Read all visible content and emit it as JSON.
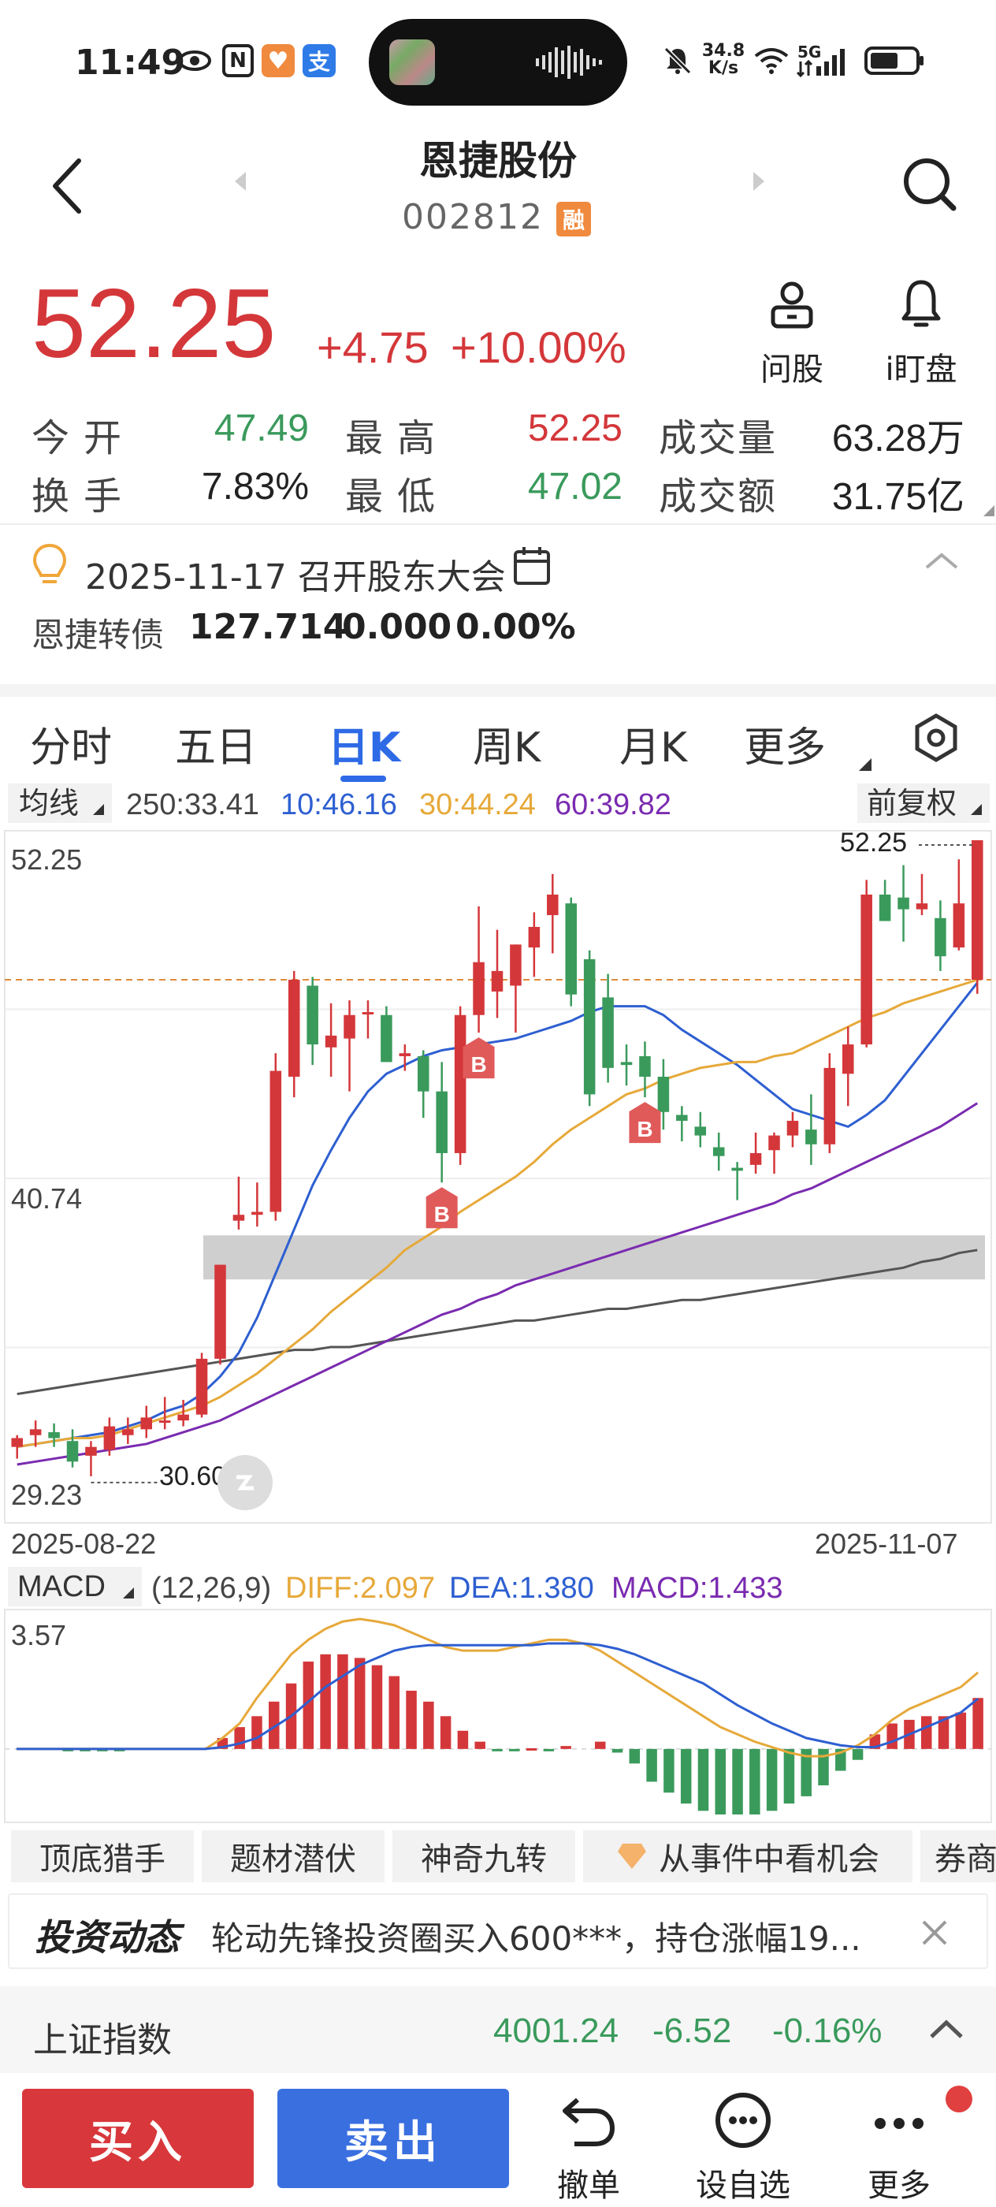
{
  "status_bar": {
    "time": "11:49",
    "net_speed_value": "34.8",
    "net_speed_unit": "K/s",
    "signal": "5G",
    "nfc_label": "N",
    "alipay_label": "支"
  },
  "header": {
    "name": "恩捷股份",
    "code": "002812",
    "margin_badge": "融"
  },
  "quote": {
    "price": "52.25",
    "change": "+4.75",
    "change_pct": "+10.00%",
    "ask_label": "问股",
    "watch_label": "i盯盘",
    "stats": [
      {
        "label": "今开",
        "value": "47.49",
        "color": "#3a9a5c"
      },
      {
        "label": "最高",
        "value": "52.25",
        "color": "#d4373a"
      },
      {
        "label": "成交量",
        "value": "63.28万",
        "color": "#222"
      },
      {
        "label": "换手",
        "value": "7.83%",
        "color": "#222"
      },
      {
        "label": "最低",
        "value": "47.02",
        "color": "#3a9a5c"
      },
      {
        "label": "成交额",
        "value": "31.75亿",
        "color": "#222"
      }
    ]
  },
  "notice": {
    "event": "2025-11-17 召开股东大会",
    "bond_name": "恩捷转债",
    "bond_price": "127.714",
    "bond_change": "0.000",
    "bond_pct": "0.00%"
  },
  "tabs": [
    "分时",
    "五日",
    "日K",
    "周K",
    "月K",
    "更多"
  ],
  "active_tab": "日K",
  "ma_bar": {
    "label": "均线",
    "ma250": "250:33.41",
    "ma10": "10:46.16",
    "ma30": "30:44.24",
    "ma60": "60:39.82",
    "adjust": "前复权"
  },
  "colors": {
    "up": "#d4373a",
    "down": "#3a9a5c",
    "ma10": "#2e5fd1",
    "ma30": "#e6a93a",
    "ma60": "#7a2bb0",
    "ma250": "#555555",
    "accent": "#2e6ae6",
    "signal_b": "#e05a5a"
  },
  "chart_data": [
    {
      "type": "candlestick",
      "y_labels": [
        "52.25",
        "40.74",
        "29.23"
      ],
      "ylim": [
        29.23,
        52.25
      ],
      "x_start": "2025-08-22",
      "x_end": "2025-11-07",
      "max_label": "52.25",
      "min_label": "30.60",
      "reference_price": 47.5,
      "support_zone": [
        37.3,
        38.8
      ],
      "signal_label": "B",
      "signals_at_index": [
        23,
        25,
        34
      ],
      "candles": [
        {
          "o": 31.6,
          "h": 32.0,
          "l": 31.2,
          "c": 31.9
        },
        {
          "o": 32.0,
          "h": 32.5,
          "l": 31.6,
          "c": 32.2
        },
        {
          "o": 32.1,
          "h": 32.4,
          "l": 31.6,
          "c": 31.9
        },
        {
          "o": 31.8,
          "h": 32.2,
          "l": 30.9,
          "c": 31.1
        },
        {
          "o": 31.3,
          "h": 31.8,
          "l": 30.6,
          "c": 31.6
        },
        {
          "o": 31.5,
          "h": 32.6,
          "l": 31.3,
          "c": 32.3
        },
        {
          "o": 32.0,
          "h": 32.6,
          "l": 31.7,
          "c": 32.2
        },
        {
          "o": 32.2,
          "h": 33.0,
          "l": 31.9,
          "c": 32.6
        },
        {
          "o": 32.5,
          "h": 33.3,
          "l": 32.2,
          "c": 32.5
        },
        {
          "o": 32.5,
          "h": 33.2,
          "l": 32.3,
          "c": 32.7
        },
        {
          "o": 32.7,
          "h": 34.8,
          "l": 32.6,
          "c": 34.6
        },
        {
          "o": 34.6,
          "h": 37.8,
          "l": 34.4,
          "c": 37.8
        },
        {
          "o": 39.3,
          "h": 40.8,
          "l": 39.0,
          "c": 39.5
        },
        {
          "o": 39.5,
          "h": 40.6,
          "l": 39.1,
          "c": 39.6
        },
        {
          "o": 39.6,
          "h": 45.0,
          "l": 39.3,
          "c": 44.4
        },
        {
          "o": 44.2,
          "h": 47.8,
          "l": 43.5,
          "c": 47.5
        },
        {
          "o": 47.3,
          "h": 47.6,
          "l": 44.6,
          "c": 45.3
        },
        {
          "o": 45.2,
          "h": 46.7,
          "l": 44.2,
          "c": 45.6
        },
        {
          "o": 45.5,
          "h": 46.8,
          "l": 43.7,
          "c": 46.3
        },
        {
          "o": 46.4,
          "h": 46.8,
          "l": 45.5,
          "c": 46.4
        },
        {
          "o": 46.3,
          "h": 46.6,
          "l": 45.0,
          "c": 44.7
        },
        {
          "o": 44.9,
          "h": 45.3,
          "l": 44.4,
          "c": 45.0
        },
        {
          "o": 44.9,
          "h": 45.1,
          "l": 42.8,
          "c": 43.7
        },
        {
          "o": 43.7,
          "h": 44.7,
          "l": 40.6,
          "c": 41.6
        },
        {
          "o": 41.6,
          "h": 46.6,
          "l": 41.2,
          "c": 46.3
        },
        {
          "o": 46.3,
          "h": 50.0,
          "l": 45.7,
          "c": 48.1
        },
        {
          "o": 47.1,
          "h": 49.2,
          "l": 46.2,
          "c": 47.8
        },
        {
          "o": 47.3,
          "h": 48.7,
          "l": 45.7,
          "c": 48.7
        },
        {
          "o": 48.6,
          "h": 49.8,
          "l": 47.6,
          "c": 49.3
        },
        {
          "o": 49.7,
          "h": 51.1,
          "l": 48.4,
          "c": 50.4
        },
        {
          "o": 50.1,
          "h": 50.3,
          "l": 46.6,
          "c": 47.0
        },
        {
          "o": 48.2,
          "h": 48.5,
          "l": 43.2,
          "c": 43.6
        },
        {
          "o": 46.9,
          "h": 47.7,
          "l": 44.0,
          "c": 44.5
        },
        {
          "o": 44.7,
          "h": 45.3,
          "l": 43.9,
          "c": 44.6
        },
        {
          "o": 44.9,
          "h": 45.4,
          "l": 43.5,
          "c": 44.2
        },
        {
          "o": 44.2,
          "h": 44.8,
          "l": 42.4,
          "c": 43.0
        },
        {
          "o": 42.9,
          "h": 43.2,
          "l": 42.0,
          "c": 42.7
        },
        {
          "o": 42.5,
          "h": 43.0,
          "l": 41.8,
          "c": 42.2
        },
        {
          "o": 41.8,
          "h": 42.3,
          "l": 41.0,
          "c": 41.5
        },
        {
          "o": 41.1,
          "h": 41.3,
          "l": 40.0,
          "c": 41.0
        },
        {
          "o": 41.2,
          "h": 42.3,
          "l": 40.9,
          "c": 41.6
        },
        {
          "o": 41.7,
          "h": 42.3,
          "l": 40.9,
          "c": 42.2
        },
        {
          "o": 42.2,
          "h": 43.0,
          "l": 41.8,
          "c": 42.7
        },
        {
          "o": 42.4,
          "h": 43.6,
          "l": 41.2,
          "c": 41.9
        },
        {
          "o": 41.9,
          "h": 45.0,
          "l": 41.6,
          "c": 44.5
        },
        {
          "o": 44.3,
          "h": 45.9,
          "l": 43.2,
          "c": 45.3
        },
        {
          "o": 45.3,
          "h": 50.9,
          "l": 45.2,
          "c": 50.4
        },
        {
          "o": 50.4,
          "h": 50.9,
          "l": 49.5,
          "c": 49.5
        },
        {
          "o": 50.3,
          "h": 51.4,
          "l": 48.8,
          "c": 49.9
        },
        {
          "o": 49.9,
          "h": 51.1,
          "l": 49.7,
          "c": 50.1
        },
        {
          "o": 49.6,
          "h": 50.2,
          "l": 47.8,
          "c": 48.3
        },
        {
          "o": 48.6,
          "h": 51.6,
          "l": 48.5,
          "c": 50.1
        },
        {
          "o": 47.5,
          "h": 52.25,
          "l": 47.02,
          "c": 52.25
        }
      ],
      "series": [
        {
          "name": "250",
          "values": [
            33.4,
            33.5,
            33.6,
            33.7,
            33.8,
            33.9,
            34.0,
            34.1,
            34.2,
            34.3,
            34.4,
            34.5,
            34.6,
            34.7,
            34.8,
            34.9,
            34.9,
            35.0,
            35.0,
            35.1,
            35.2,
            35.3,
            35.4,
            35.5,
            35.6,
            35.7,
            35.8,
            35.9,
            35.9,
            36.0,
            36.1,
            36.2,
            36.3,
            36.3,
            36.4,
            36.5,
            36.6,
            36.6,
            36.7,
            36.8,
            36.9,
            37.0,
            37.1,
            37.2,
            37.3,
            37.4,
            37.5,
            37.6,
            37.7,
            37.9,
            38.0,
            38.2,
            38.3
          ]
        },
        {
          "name": "10",
          "values": [
            31.6,
            31.7,
            31.8,
            31.9,
            32.0,
            32.1,
            32.3,
            32.5,
            32.8,
            33.0,
            33.4,
            34.0,
            34.8,
            36.0,
            37.5,
            39.0,
            40.5,
            41.7,
            42.8,
            43.7,
            44.3,
            44.6,
            44.9,
            45.1,
            45.2,
            45.3,
            45.4,
            45.5,
            45.7,
            45.9,
            46.1,
            46.4,
            46.6,
            46.6,
            46.6,
            46.3,
            45.8,
            45.4,
            45.0,
            44.6,
            44.1,
            43.6,
            43.1,
            42.9,
            42.7,
            42.5,
            42.9,
            43.4,
            44.2,
            45.0,
            45.8,
            46.6,
            47.4
          ]
        },
        {
          "name": "30",
          "values": [
            31.6,
            31.7,
            31.8,
            31.9,
            31.9,
            32.0,
            32.2,
            32.4,
            32.6,
            32.8,
            33.0,
            33.3,
            33.7,
            34.1,
            34.6,
            35.1,
            35.6,
            36.2,
            36.7,
            37.2,
            37.7,
            38.3,
            38.7,
            39.1,
            39.6,
            40.0,
            40.4,
            40.8,
            41.3,
            41.9,
            42.4,
            42.8,
            43.2,
            43.6,
            43.8,
            44.1,
            44.3,
            44.5,
            44.6,
            44.7,
            44.7,
            44.9,
            45.0,
            45.3,
            45.6,
            45.9,
            46.2,
            46.4,
            46.7,
            46.9,
            47.1,
            47.3,
            47.5
          ]
        },
        {
          "name": "60",
          "values": [
            31.0,
            31.1,
            31.2,
            31.3,
            31.4,
            31.5,
            31.6,
            31.7,
            31.9,
            32.1,
            32.3,
            32.5,
            32.8,
            33.1,
            33.4,
            33.7,
            34.0,
            34.3,
            34.6,
            34.9,
            35.2,
            35.5,
            35.8,
            36.1,
            36.3,
            36.6,
            36.8,
            37.1,
            37.3,
            37.5,
            37.7,
            37.9,
            38.1,
            38.3,
            38.5,
            38.7,
            38.9,
            39.1,
            39.3,
            39.5,
            39.7,
            39.9,
            40.2,
            40.4,
            40.7,
            41.0,
            41.3,
            41.6,
            41.9,
            42.2,
            42.5,
            42.9,
            43.3
          ]
        }
      ]
    },
    {
      "type": "bar",
      "title": "MACD",
      "params": "(12,26,9)",
      "diff_label": "DIFF:2.097",
      "dea_label": "DEA:1.380",
      "macd_label": "MACD:1.433",
      "y_top_label": "3.57",
      "ylim": [
        -1.8,
        3.57
      ],
      "histogram": [
        0,
        0,
        0,
        -0.05,
        -0.05,
        -0.05,
        -0.03,
        0,
        0,
        0,
        0,
        0,
        0.3,
        0.6,
        0.9,
        1.3,
        1.8,
        2.4,
        2.6,
        2.6,
        2.5,
        2.3,
        2.0,
        1.6,
        1.3,
        0.9,
        0.5,
        0.2,
        -0.05,
        -0.03,
        0.02,
        -0.03,
        0.08,
        0,
        0.2,
        -0.1,
        -0.4,
        -0.9,
        -1.2,
        -1.5,
        -1.7,
        -1.8,
        -1.8,
        -1.8,
        -1.7,
        -1.5,
        -1.3,
        -1.0,
        -0.6,
        -0.3,
        0.4,
        0.7,
        0.8,
        0.9,
        0.9,
        1.0,
        1.4
      ],
      "series": [
        {
          "name": "DIFF",
          "values": [
            0,
            0,
            0,
            0,
            0,
            0,
            0,
            0,
            0,
            0,
            0,
            0,
            0.3,
            0.7,
            1.4,
            2.0,
            2.6,
            3.0,
            3.3,
            3.5,
            3.57,
            3.5,
            3.4,
            3.2,
            3.0,
            2.8,
            2.7,
            2.7,
            2.7,
            2.8,
            2.9,
            3.0,
            3.0,
            2.9,
            2.7,
            2.4,
            2.1,
            1.8,
            1.5,
            1.2,
            0.9,
            0.6,
            0.4,
            0.2,
            0.05,
            -0.1,
            -0.2,
            -0.2,
            -0.1,
            0.1,
            0.4,
            0.8,
            1.1,
            1.3,
            1.5,
            1.7,
            2.1
          ]
        },
        {
          "name": "DEA",
          "values": [
            0,
            0,
            0,
            0,
            0,
            0,
            0,
            0,
            0,
            0,
            0,
            0,
            0.05,
            0.15,
            0.3,
            0.6,
            0.9,
            1.3,
            1.7,
            2.0,
            2.3,
            2.5,
            2.7,
            2.8,
            2.85,
            2.85,
            2.85,
            2.85,
            2.85,
            2.85,
            2.85,
            2.9,
            2.9,
            2.9,
            2.85,
            2.75,
            2.6,
            2.4,
            2.2,
            2.0,
            1.8,
            1.5,
            1.2,
            0.95,
            0.7,
            0.5,
            0.3,
            0.2,
            0.1,
            0.05,
            0.05,
            0.2,
            0.4,
            0.6,
            0.8,
            1.0,
            1.38
          ]
        }
      ]
    }
  ],
  "tools": [
    "顶底猎手",
    "题材潜伏",
    "神奇九转",
    "从事件中看机会",
    "券商"
  ],
  "feed": {
    "brand": "投资动态",
    "text": "轮动先锋投资圈买入600***，持仓涨幅19..."
  },
  "index": {
    "name": "上证指数",
    "value": "4001.24",
    "change": "-6.52",
    "pct": "-0.16%"
  },
  "bottom_bar": {
    "buy": "买入",
    "sell": "卖出",
    "cancel": "撤单",
    "favorite": "设自选",
    "more": "更多"
  }
}
